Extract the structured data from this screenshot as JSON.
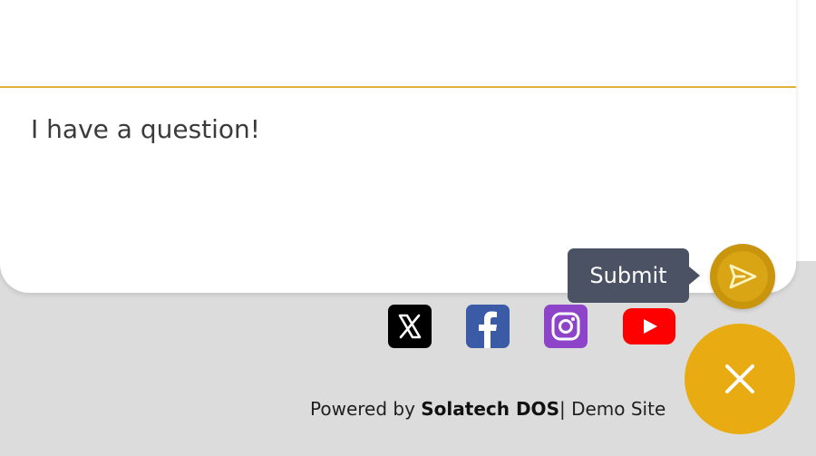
{
  "composer": {
    "input_value": "I have a question!",
    "submit_tooltip": "Submit",
    "submit_icon": "send-icon"
  },
  "social_links": [
    {
      "name": "x-twitter-icon",
      "color": "#000000"
    },
    {
      "name": "facebook-icon",
      "color": "#3b5ba7"
    },
    {
      "name": "instagram-icon",
      "color": "#8e44c8"
    },
    {
      "name": "youtube-icon",
      "color": "#ff0000"
    }
  ],
  "footer": {
    "powered_by_prefix": "Powered by ",
    "brand": "Solatech DOS",
    "separator": "| ",
    "site_label": "Demo Site"
  },
  "fab": {
    "icon": "close-icon"
  },
  "colors": {
    "accent": "#e8ac12",
    "divider": "#e0b23c",
    "tooltip_bg": "#4a5263",
    "page_background": "#dcdcdc"
  }
}
